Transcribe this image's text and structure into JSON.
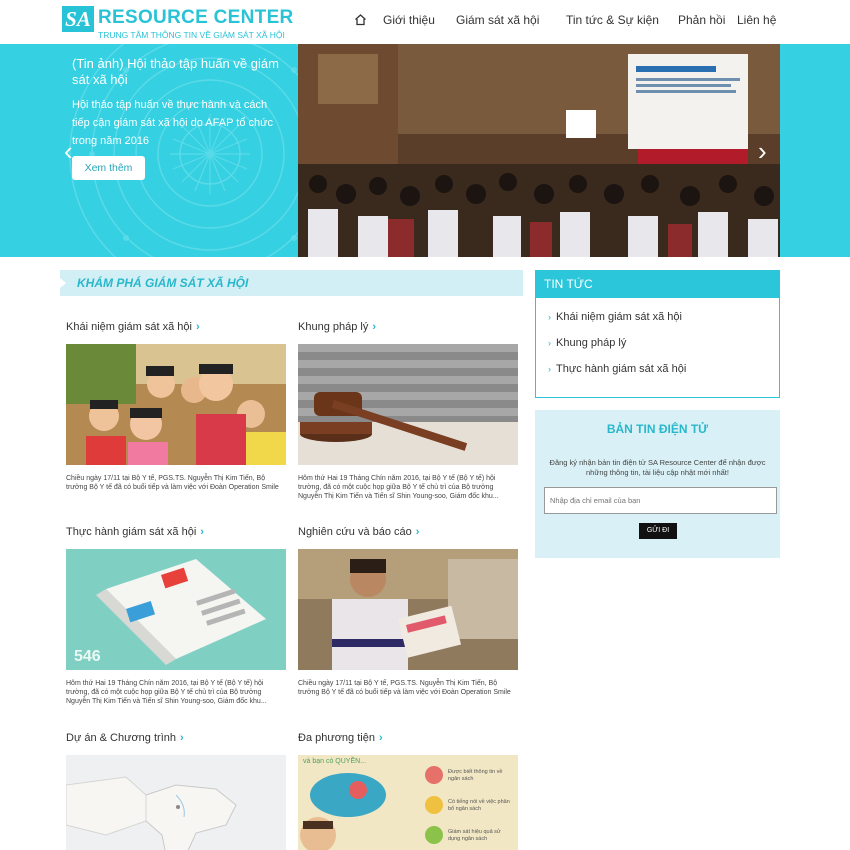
{
  "header": {
    "logo": {
      "mark": "SA",
      "title": "RESOURCE CENTER",
      "subtitle": "TRUNG TÂM THÔNG TIN VỀ GIÁM SÁT XÃ HỘI"
    },
    "nav": [
      "Giới thiệu",
      "Giám sát xã hội",
      "Tin tức & Sự kiện",
      "Phản hồi",
      "Liên hệ"
    ],
    "home_icon": "home-icon"
  },
  "banner": {
    "title": "(Tin ảnh) Hội thảo tập huấn về giám sát xã hội",
    "description": "Hội thảo tập huấn về thực hành và cách tiếp cận giám sát xã hội do AFAP tổ chức trong năm 2016",
    "button": "Xem thêm",
    "prev_icon": "‹",
    "next_icon": "›"
  },
  "explore": {
    "heading": "Khám phá giám sát xã hội",
    "cards": [
      {
        "title": "Khái niệm giám sát xã hội",
        "caption": "Chiều ngày 17/11 tại Bộ Y tế, PGS.TS. Nguyễn Thị Kim Tiến, Bộ trưởng Bộ Y tế đã có buổi tiếp và làm việc với Đoàn Operation Smile"
      },
      {
        "title": "Khung pháp lý",
        "caption": "Hôm thứ Hai 19 Tháng Chín năm 2016, tại Bộ Y tế (Bộ Y tế) hội trường, đã có một cuộc họp giữa Bộ Y tế chủ trì của Bộ trưởng Nguyễn Thị Kim Tiến và Tiến sĩ Shin Young-soo, Giám đốc khu..."
      },
      {
        "title": "Thực hành giám sát xã hội",
        "caption": "Hôm thứ Hai 19 Tháng Chín năm 2016, tại Bộ Y tế (Bộ Y tế) hội trường, đã có một cuộc họp giữa Bộ Y tế chủ trì của Bộ trưởng Nguyễn Thị Kim Tiến và Tiến sĩ Shin Young-soo, Giám đốc khu..."
      },
      {
        "title": "Nghiên cứu và báo cáo",
        "caption": "Chiều ngày 17/11 tại Bộ Y tế, PGS.TS. Nguyễn Thị Kim Tiến, Bộ trưởng Bộ Y tế đã có buổi tiếp và làm việc với Đoàn Operation Smile"
      },
      {
        "title": "Dự án & Chương trình",
        "caption": ""
      },
      {
        "title": "Đa phương tiện",
        "caption": ""
      }
    ],
    "brochure_number": "546",
    "infographic": {
      "headline": "và bạn có QUYỀN...",
      "items": [
        "Được biết thông tin về ngân sách",
        "Có tiếng nói về việc phân bổ ngân sách",
        "Giám sát hiệu quả sử dụng ngân sách"
      ]
    }
  },
  "sidebar": {
    "news": {
      "heading": "TIN TỨC",
      "items": [
        "Khái niệm giám sát xã hội",
        "Khung pháp lý",
        "Thực hành giám sát xã hội"
      ]
    },
    "newsletter": {
      "heading": "BẢN TIN ĐIỆN TỬ",
      "description": "Đăng ký nhận bản tin điện tử SA Resource Center để nhận được những thông tin, tài liệu cập nhật mới nhất!",
      "placeholder": "Nhập địa chỉ email của bạn",
      "button": "GỬI ĐI"
    }
  },
  "colors": {
    "accent": "#29c3d8",
    "banner": "#35d0e1",
    "light": "#d9f1f6"
  }
}
